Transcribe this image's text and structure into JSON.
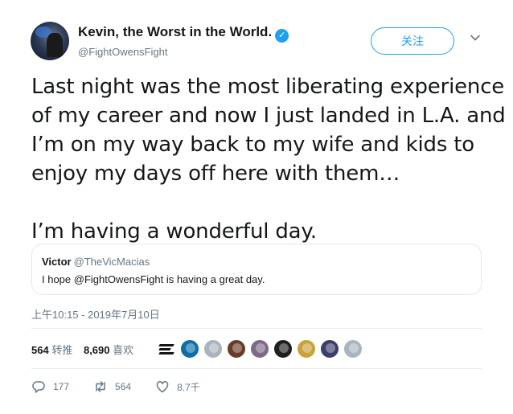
{
  "author": {
    "name": "Kevin, the Worst in the World.",
    "verified_glyph": "✓",
    "handle": "@FightOwensFight"
  },
  "header": {
    "follow_label": "关注",
    "menu_icon": "chevron-down-icon"
  },
  "tweet": {
    "lines": [
      "Last night was the most liberating experience",
      "of my career and now I just landed in L.A. and",
      "I’m on my way back to my wife and kids to",
      "enjoy my days off here with them…",
      "I’m having a wonderful day."
    ]
  },
  "quote": {
    "name": "Victor",
    "handle": "@TheVicMacias",
    "text": "I hope @FightOwensFight is having a great day."
  },
  "timestamp": "上午10:15 - 2019年7月10日",
  "stats": {
    "retweets_count": "564",
    "retweets_label": "转推",
    "likes_count": "8,690",
    "likes_label": "喜欢"
  },
  "likers": {
    "colors": [
      "#0e6fa8",
      "#aab4be",
      "#6b3b2a",
      "#7d6b86",
      "#1f1f1f",
      "#c8a23a",
      "#3a3f6b",
      "#aab4be"
    ]
  },
  "actions": {
    "reply_count": "177",
    "retweet_count": "564",
    "like_count": "8.7千"
  },
  "colors": {
    "accent": "#1da1f2",
    "muted": "#657786",
    "text": "#14171a"
  }
}
